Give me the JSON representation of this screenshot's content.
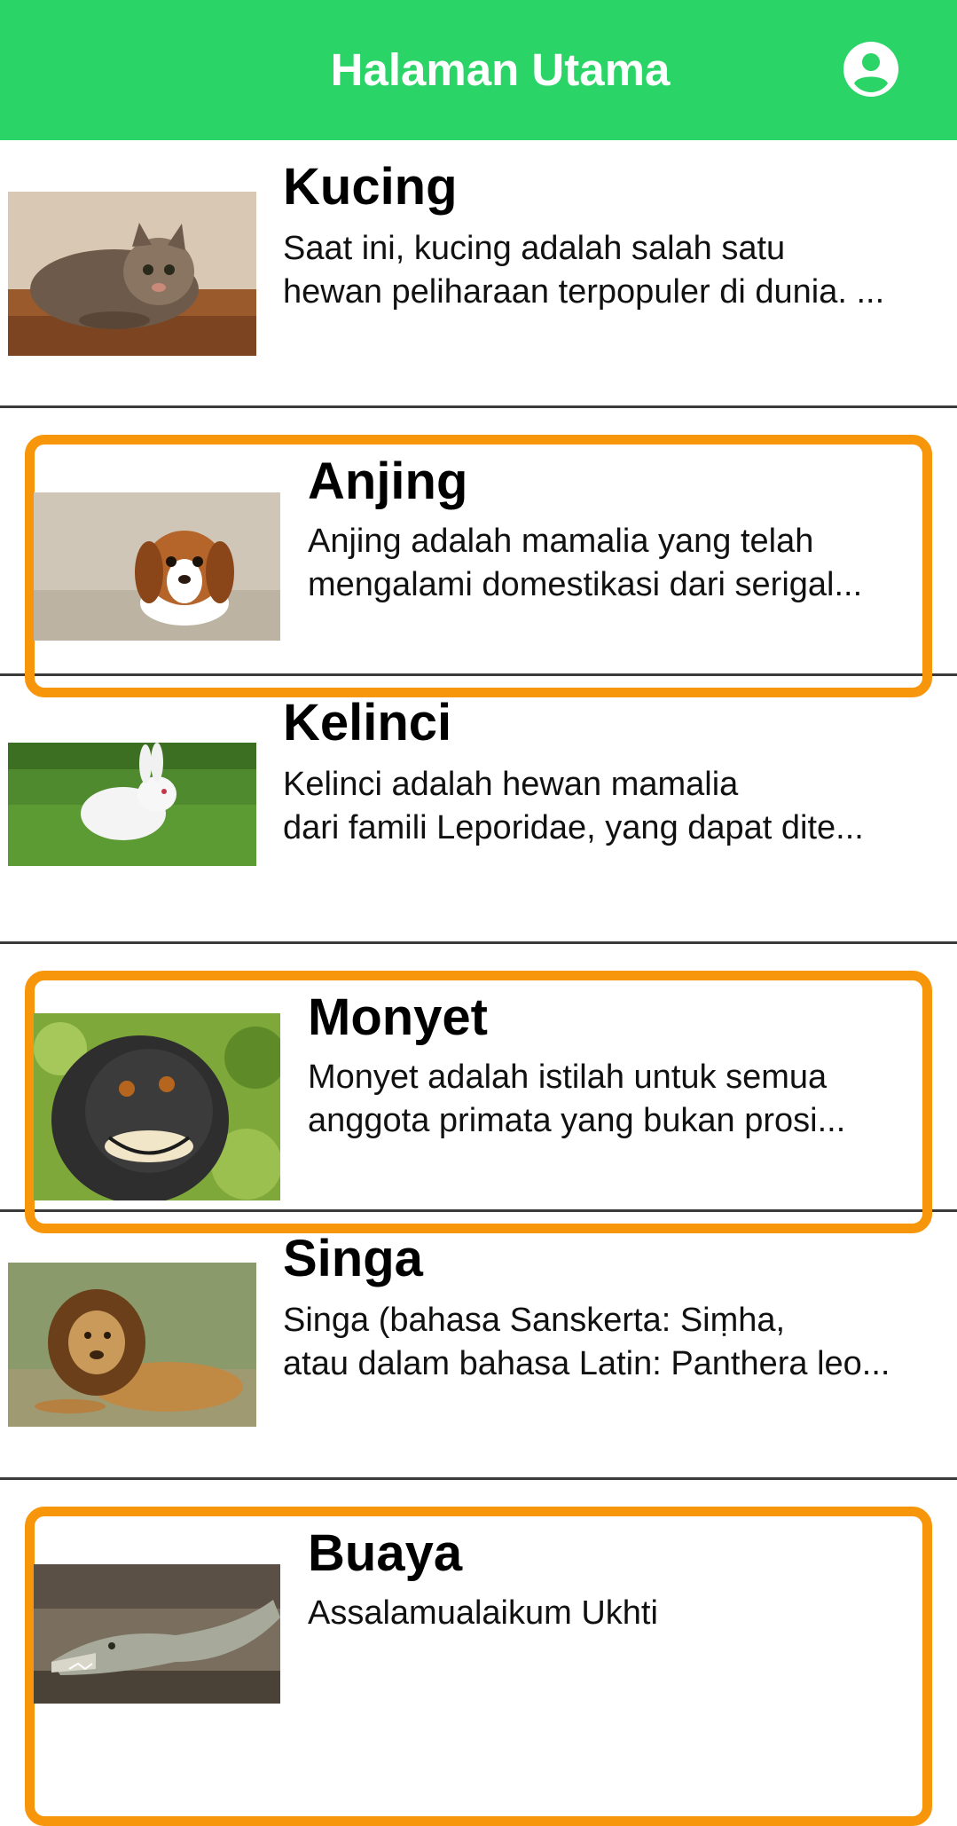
{
  "app_bar": {
    "title": "Halaman Utama",
    "profile_icon": "account-circle-icon",
    "background": "#2bd467"
  },
  "highlight_color": "#f7950b",
  "animals": [
    {
      "name": "Kucing",
      "desc_line1": "Saat ini, kucing adalah salah satu",
      "desc_line2": "hewan peliharaan terpopuler di dunia. ...",
      "image": "cat-photo",
      "highlighted": false
    },
    {
      "name": "Anjing",
      "desc_line1": "Anjing adalah mamalia yang telah",
      "desc_line2": "mengalami domestikasi dari serigal...",
      "image": "dog-photo",
      "highlighted": true
    },
    {
      "name": "Kelinci",
      "desc_line1": "Kelinci adalah hewan mamalia",
      "desc_line2": "dari famili Leporidae, yang dapat dite...",
      "image": "rabbit-photo",
      "highlighted": false
    },
    {
      "name": "Monyet",
      "desc_line1": "Monyet adalah istilah untuk semua",
      "desc_line2": "anggota primata yang bukan prosi...",
      "image": "monkey-photo",
      "highlighted": true
    },
    {
      "name": "Singa",
      "desc_line1": "Singa (bahasa Sanskerta: Siṃha,",
      "desc_line2": "atau dalam bahasa Latin: Panthera leo...",
      "image": "lion-photo",
      "highlighted": false
    },
    {
      "name": "Buaya",
      "desc_line1": "Assalamualaikum Ukhti",
      "desc_line2": "",
      "image": "crocodile-photo",
      "highlighted": true
    }
  ]
}
